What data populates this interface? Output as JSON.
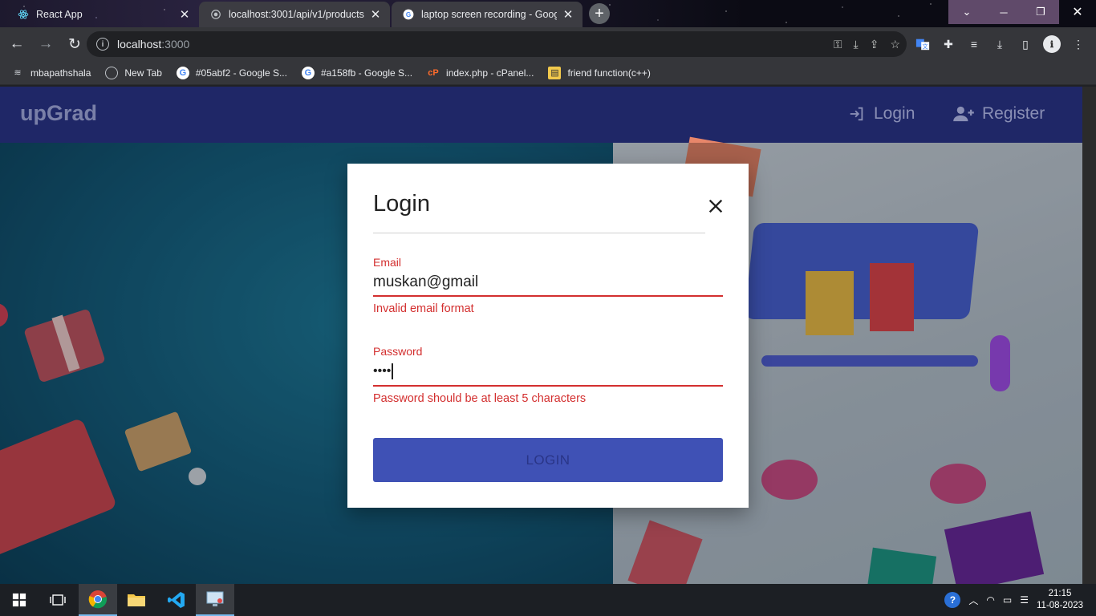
{
  "browser": {
    "tabs": [
      {
        "title": "React App",
        "icon": "react-icon",
        "active": true
      },
      {
        "title": "localhost:3001/api/v1/products",
        "icon": "globe-icon",
        "active": false
      },
      {
        "title": "laptop screen recording - Google",
        "icon": "google-icon",
        "active": false
      }
    ],
    "url_host": "localhost",
    "url_port": ":3000",
    "bookmarks": [
      {
        "label": "mbapathshala",
        "icon": "mbapathshala-icon"
      },
      {
        "label": "New Tab",
        "icon": "globe-icon"
      },
      {
        "label": "#05abf2 - Google S...",
        "icon": "google-icon"
      },
      {
        "label": "#a158fb - Google S...",
        "icon": "google-icon"
      },
      {
        "label": "index.php - cPanel...",
        "icon": "cpanel-icon"
      },
      {
        "label": "friend function(c++)",
        "icon": "bookmark-icon"
      }
    ]
  },
  "app": {
    "brand": "upGrad",
    "nav": {
      "login_label": "Login",
      "register_label": "Register"
    }
  },
  "login_dialog": {
    "title": "Login",
    "email": {
      "label": "Email",
      "value": "muskan@gmail",
      "error": "Invalid email format"
    },
    "password": {
      "label": "Password",
      "value": "••••",
      "error": "Password should be at least 5 characters"
    },
    "submit_label": "LOGIN",
    "error_color": "#d32f2f",
    "button_color": "#3f51b5"
  },
  "taskbar": {
    "time": "21:15",
    "date": "11-08-2023"
  }
}
